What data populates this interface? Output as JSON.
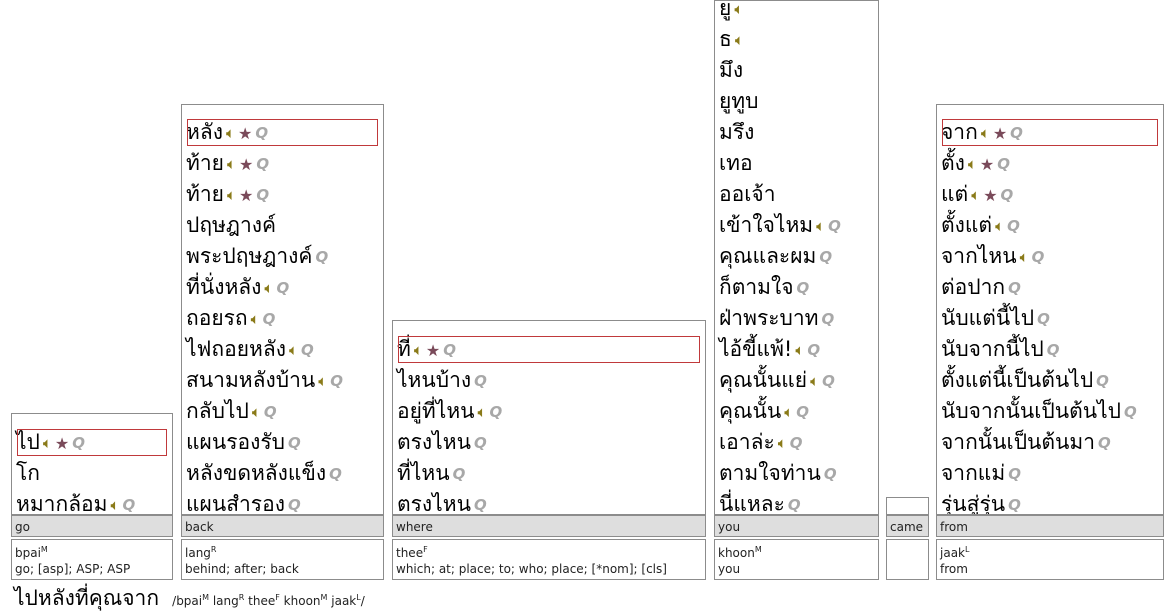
{
  "columns": [
    {
      "header": "go",
      "items": [
        {
          "text": "ไป",
          "speaker": true,
          "star": true,
          "lookup": true,
          "selected": true
        },
        {
          "text": "โก",
          "speaker": false,
          "star": false,
          "lookup": false
        },
        {
          "text": "หมากล้อม",
          "speaker": true,
          "star": false,
          "lookup": true
        }
      ],
      "gloss": {
        "translit": "bpai",
        "tone": "M",
        "meaning": "go; [asp]; ASP; ASP"
      }
    },
    {
      "header": "back",
      "items": [
        {
          "text": "หลัง",
          "speaker": true,
          "star": true,
          "lookup": true,
          "selected": true
        },
        {
          "text": "ท้าย",
          "speaker": true,
          "star": true,
          "lookup": true
        },
        {
          "text": "ท้าย",
          "speaker": true,
          "star": true,
          "lookup": true
        },
        {
          "text": "ปฤษฎางค์",
          "speaker": false,
          "star": false,
          "lookup": false
        },
        {
          "text": "พระปฤษฎางค์",
          "speaker": false,
          "star": false,
          "lookup": true
        },
        {
          "text": "ที่นั่งหลัง",
          "speaker": true,
          "star": false,
          "lookup": true
        },
        {
          "text": "ถอยรถ",
          "speaker": true,
          "star": false,
          "lookup": true
        },
        {
          "text": "ไฟถอยหลัง",
          "speaker": true,
          "star": false,
          "lookup": true
        },
        {
          "text": "สนามหลังบ้าน",
          "speaker": true,
          "star": false,
          "lookup": true
        },
        {
          "text": "กลับไป",
          "speaker": true,
          "star": false,
          "lookup": true
        },
        {
          "text": "แผนรองรับ",
          "speaker": false,
          "star": false,
          "lookup": true
        },
        {
          "text": "หลังขดหลังแข็ง",
          "speaker": false,
          "star": false,
          "lookup": true
        },
        {
          "text": "แผนสำรอง",
          "speaker": false,
          "star": false,
          "lookup": true
        }
      ],
      "gloss": {
        "translit": "lang",
        "tone": "R",
        "meaning": "behind; after; back"
      }
    },
    {
      "header": "where",
      "items": [
        {
          "text": "ที่",
          "speaker": true,
          "star": true,
          "lookup": true,
          "selected": true
        },
        {
          "text": "ไหนบ้าง",
          "speaker": false,
          "star": false,
          "lookup": true
        },
        {
          "text": "อยู่ที่ไหน",
          "speaker": true,
          "star": false,
          "lookup": true
        },
        {
          "text": "ตรงไหน",
          "speaker": false,
          "star": false,
          "lookup": true
        },
        {
          "text": "ที่ไหน",
          "speaker": false,
          "star": false,
          "lookup": true
        },
        {
          "text": "ตรงไหน",
          "speaker": false,
          "star": false,
          "lookup": true
        }
      ],
      "gloss": {
        "translit": "thee",
        "tone": "F",
        "meaning": "which; at; place; to; who; place; [*nom]; [cls]"
      }
    },
    {
      "header": "you",
      "items": [
        {
          "text": "ยู",
          "speaker": true,
          "star": false,
          "lookup": false
        },
        {
          "text": "ธ",
          "speaker": true,
          "star": false,
          "lookup": false
        },
        {
          "text": "มึง",
          "speaker": false,
          "star": false,
          "lookup": false
        },
        {
          "text": "ยูทูบ",
          "speaker": false,
          "star": false,
          "lookup": false
        },
        {
          "text": "มรึง",
          "speaker": false,
          "star": false,
          "lookup": false
        },
        {
          "text": "เทอ",
          "speaker": false,
          "star": false,
          "lookup": false
        },
        {
          "text": "ออเจ้า",
          "speaker": false,
          "star": false,
          "lookup": false
        },
        {
          "text": "เข้าใจไหม",
          "speaker": true,
          "star": false,
          "lookup": true
        },
        {
          "text": "คุณและผม",
          "speaker": false,
          "star": false,
          "lookup": true
        },
        {
          "text": "ก็ตามใจ",
          "speaker": false,
          "star": false,
          "lookup": true
        },
        {
          "text": "ฝ่าพระบาท",
          "speaker": false,
          "star": false,
          "lookup": true
        },
        {
          "text": "ไอ้ขี้แพ้!",
          "speaker": true,
          "star": false,
          "lookup": true
        },
        {
          "text": "คุณนั้นแย่",
          "speaker": true,
          "star": false,
          "lookup": true
        },
        {
          "text": "คุณนั้น",
          "speaker": true,
          "star": false,
          "lookup": true
        },
        {
          "text": "เอาล่ะ",
          "speaker": true,
          "star": false,
          "lookup": true
        },
        {
          "text": "ตามใจท่าน",
          "speaker": false,
          "star": false,
          "lookup": true
        },
        {
          "text": "นี่แหละ",
          "speaker": false,
          "star": false,
          "lookup": true
        }
      ],
      "gloss": {
        "translit": "khoon",
        "tone": "M",
        "meaning": "you"
      }
    },
    {
      "header": "came",
      "items": [],
      "gloss": {
        "translit": "",
        "tone": "",
        "meaning": ""
      }
    },
    {
      "header": "from",
      "items": [
        {
          "text": "จาก",
          "speaker": true,
          "star": true,
          "lookup": true,
          "selected": true
        },
        {
          "text": "ตั้ง",
          "speaker": true,
          "star": true,
          "lookup": true
        },
        {
          "text": "แต่",
          "speaker": true,
          "star": true,
          "lookup": true
        },
        {
          "text": "ตั้งแต่",
          "speaker": true,
          "star": false,
          "lookup": true
        },
        {
          "text": "จากไหน",
          "speaker": true,
          "star": false,
          "lookup": true
        },
        {
          "text": "ต่อปาก",
          "speaker": false,
          "star": false,
          "lookup": true
        },
        {
          "text": "นับแต่นี้ไป",
          "speaker": false,
          "star": false,
          "lookup": true
        },
        {
          "text": "นับจากนี้ไป",
          "speaker": false,
          "star": false,
          "lookup": true
        },
        {
          "text": "ตั้งแต่นี้เป็นต้นไป",
          "speaker": false,
          "star": false,
          "lookup": true
        },
        {
          "text": "นับจากนั้นเป็นต้นไป",
          "speaker": false,
          "star": false,
          "lookup": true
        },
        {
          "text": "จากนั้นเป็นต้นมา",
          "speaker": false,
          "star": false,
          "lookup": true
        },
        {
          "text": "จากแม่",
          "speaker": false,
          "star": false,
          "lookup": true
        },
        {
          "text": "รุ่นสู่รุ่น",
          "speaker": false,
          "star": false,
          "lookup": true
        }
      ],
      "gloss": {
        "translit": "jaak",
        "tone": "L",
        "meaning": "from"
      }
    }
  ],
  "sentence": {
    "thai": "ไปหลังที่คุณจาก",
    "parts": [
      {
        "syl": "bpai",
        "tone": "M"
      },
      {
        "syl": "lang",
        "tone": "R"
      },
      {
        "syl": "thee",
        "tone": "F"
      },
      {
        "syl": "khoon",
        "tone": "M"
      },
      {
        "syl": "jaak",
        "tone": "L"
      }
    ]
  },
  "icons": {
    "speaker": "speaker-icon",
    "star": "star-icon",
    "lookup": "lookup-icon"
  },
  "colors": {
    "selection_border": "#c0393b",
    "header_bg": "#dedede",
    "star": "#7a4a5a",
    "speaker": "#8a7a18"
  }
}
